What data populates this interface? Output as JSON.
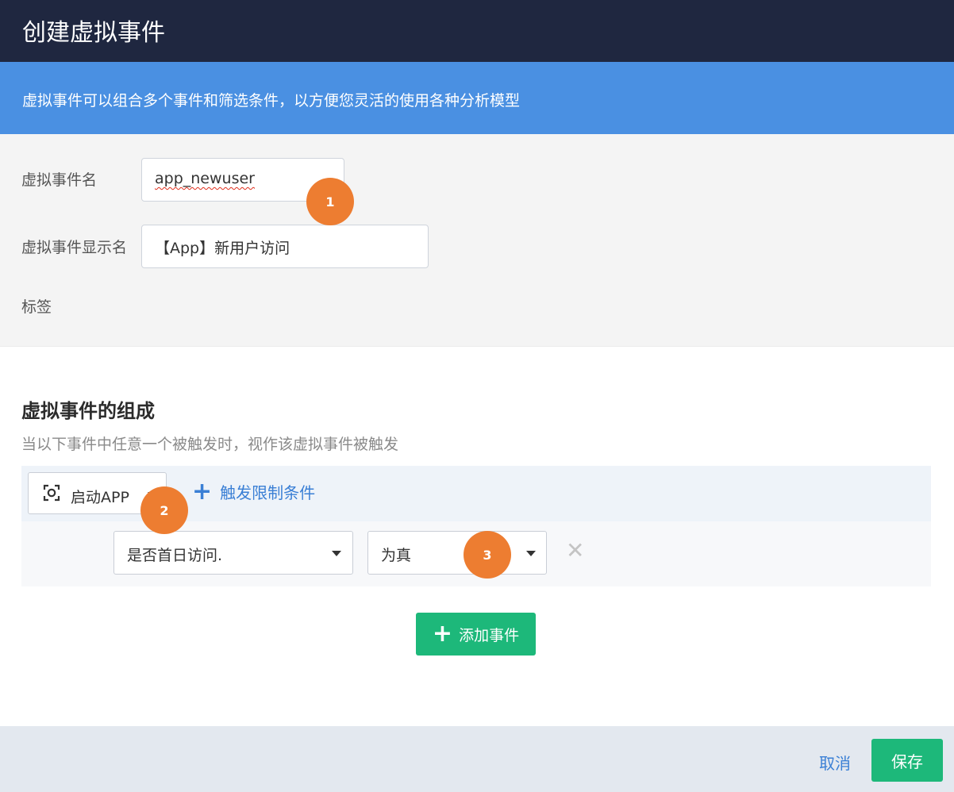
{
  "header": {
    "title": "创建虚拟事件"
  },
  "info": {
    "text": "虚拟事件可以组合多个事件和筛选条件，以方便您灵活的使用各种分析模型"
  },
  "form": {
    "name_label": "虚拟事件名",
    "name_value": "app_newuser",
    "display_label": "虚拟事件显示名",
    "display_value": "【App】新用户访问",
    "tag_label": "标签"
  },
  "composition": {
    "title": "虚拟事件的组成",
    "description": "当以下事件中任意一个被触发时，视作该虚拟事件被触发",
    "event": {
      "label": "启动APP",
      "icon": "scan-icon"
    },
    "add_condition_label": "触发限制条件",
    "condition": {
      "property": "是否首日访问.",
      "operator": "为真"
    },
    "add_event_label": "添加事件"
  },
  "badges": [
    "1",
    "2",
    "3"
  ],
  "footer": {
    "cancel_label": "取消",
    "save_label": "保存"
  },
  "colors": {
    "header_bg": "#1f2740",
    "info_bg": "#4a90e2",
    "accent_green": "#1db87a",
    "link_blue": "#3a7fd5",
    "badge_orange": "#ed7d31"
  }
}
